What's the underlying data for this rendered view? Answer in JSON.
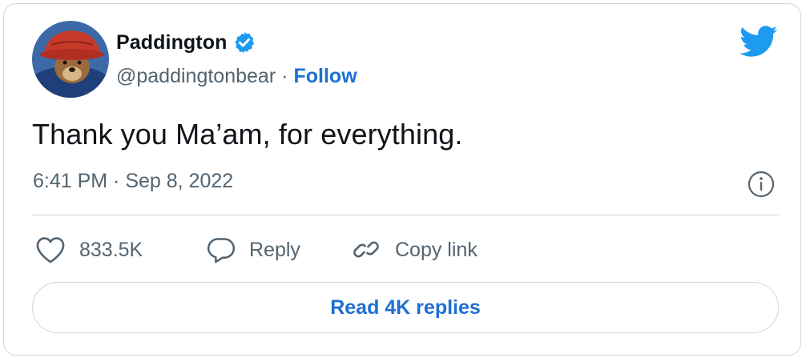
{
  "author": {
    "display_name": "Paddington",
    "handle": "@paddingtonbear",
    "separator": "·",
    "follow_label": "Follow",
    "verified": true
  },
  "tweet": {
    "text": "Thank you Ma’am, for everything.",
    "timestamp": "6:41 PM · Sep 8, 2022"
  },
  "actions": {
    "like_count": "833.5K",
    "reply_label": "Reply",
    "copy_link_label": "Copy link"
  },
  "read_replies_label": "Read 4K replies",
  "icons": [
    "paddington-avatar",
    "verified-badge-icon",
    "twitter-bird-icon",
    "info-icon",
    "heart-icon",
    "reply-bubble-icon",
    "link-icon"
  ],
  "colors": {
    "accent": "#1d6fd1",
    "twitter_blue": "#1d9bf0",
    "muted_text": "#536471",
    "border": "#cfd9de"
  }
}
